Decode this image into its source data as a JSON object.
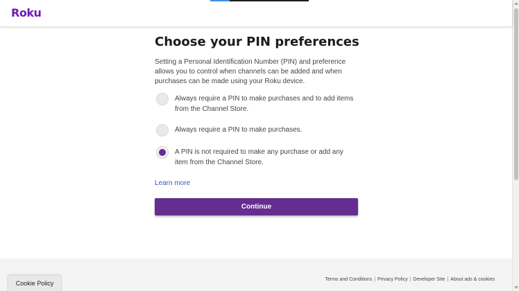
{
  "header": {
    "logo_text": "Roku",
    "brand_color": "#6f1ab1",
    "progress_fraction": 0.2
  },
  "main": {
    "title": "Choose your PIN preferences",
    "description": "Setting a Personal Identification Number (PIN) and preference allows you to control when channels can be added and when purchases can be made using your Roku device.",
    "options": [
      {
        "label": "Always require a PIN to make purchases and to add items from the Channel Store.",
        "selected": false
      },
      {
        "label": "Always require a PIN to make purchases.",
        "selected": false
      },
      {
        "label": "A PIN is not required to make any purchase or add any item from the Channel Store.",
        "selected": true
      }
    ],
    "learn_more": "Learn more",
    "continue_label": "Continue",
    "accent_color": "#662d91"
  },
  "footer": {
    "links": [
      "Terms and Conditions",
      "Privacy Policy",
      "Developer Site",
      "About ads & cookies"
    ],
    "separator": "|",
    "cookie_label": "Cookie Policy"
  }
}
